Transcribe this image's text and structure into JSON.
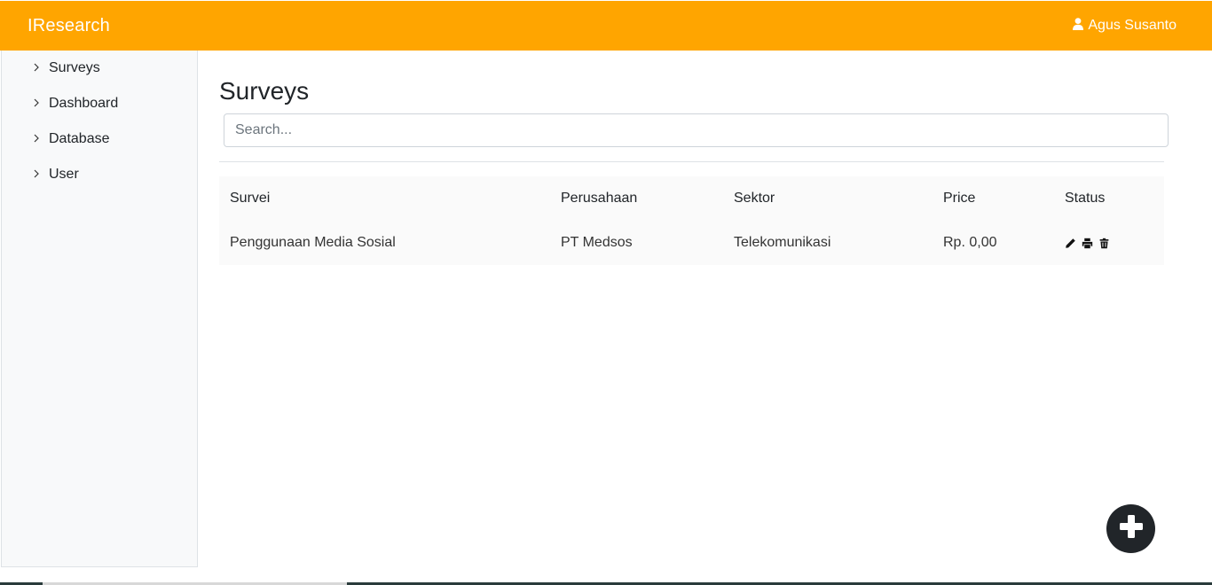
{
  "app": {
    "brand": "IResearch",
    "user_name": "Agus Susanto"
  },
  "sidebar": {
    "items": [
      {
        "label": "Surveys"
      },
      {
        "label": "Dashboard"
      },
      {
        "label": "Database"
      },
      {
        "label": "User"
      }
    ]
  },
  "main": {
    "title": "Surveys",
    "search_placeholder": "Search..."
  },
  "table": {
    "headers": [
      "Survei",
      "Perusahaan",
      "Sektor",
      "Price",
      "Status"
    ],
    "rows": [
      {
        "survei": "Penggunaan Media Sosial",
        "perusahaan": "PT Medsos",
        "sektor": "Telekomunikasi",
        "price": "Rp. 0,00"
      }
    ]
  },
  "icons": {
    "user": "user-icon",
    "chevron": "chevron-right-icon",
    "edit": "pencil-icon",
    "print": "printer-icon",
    "delete": "trash-icon",
    "add": "plus-circle-icon"
  },
  "colors": {
    "navbar": "#ffa500",
    "fab": "#212529",
    "sidebar_bg": "#f8f9fa"
  }
}
